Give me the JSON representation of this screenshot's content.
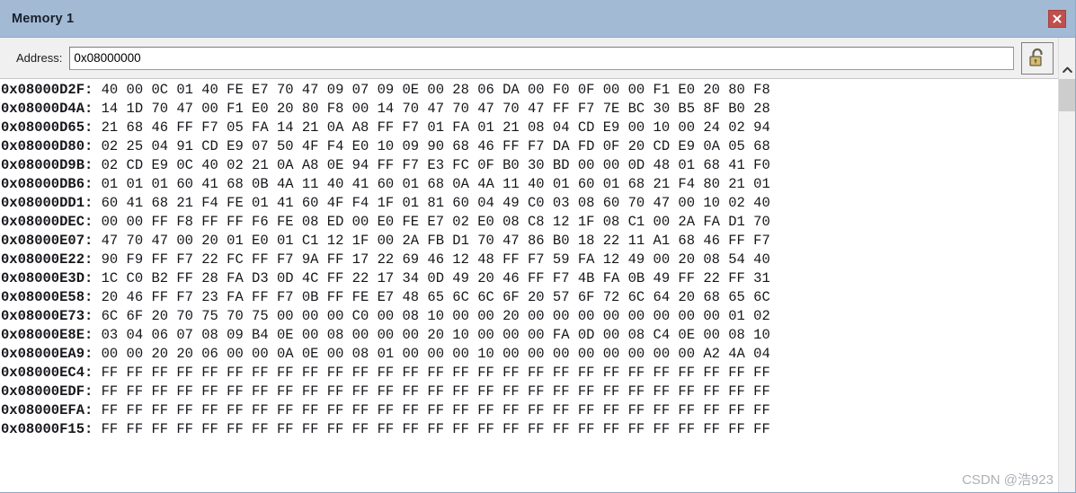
{
  "window": {
    "title": "Memory 1",
    "close_icon": "close-icon",
    "close_color": "#c0504d",
    "titlebar_color": "#a3bad4"
  },
  "toolbar": {
    "address_label": "Address:",
    "address_value": "0x08000000",
    "address_placeholder": "0x00000000",
    "lock_icon": "unlocked-padlock-icon",
    "scroll_up_icon": "chevron-up-icon"
  },
  "memory": {
    "rows": [
      {
        "address": "0x08000D2F:",
        "bytes": "40 00 0C 01 40 FE E7 70 47 09 07 09 0E 00 28 06 DA 00 F0 0F 00 00 F1 E0 20 80 F8"
      },
      {
        "address": "0x08000D4A:",
        "bytes": "14 1D 70 47 00 F1 E0 20 80 F8 00 14 70 47 70 47 70 47 FF F7 7E BC 30 B5 8F B0 28"
      },
      {
        "address": "0x08000D65:",
        "bytes": "21 68 46 FF F7 05 FA 14 21 0A A8 FF F7 01 FA 01 21 08 04 CD E9 00 10 00 24 02 94"
      },
      {
        "address": "0x08000D80:",
        "bytes": "02 25 04 91 CD E9 07 50 4F F4 E0 10 09 90 68 46 FF F7 DA FD 0F 20 CD E9 0A 05 68"
      },
      {
        "address": "0x08000D9B:",
        "bytes": "02 CD E9 0C 40 02 21 0A A8 0E 94 FF F7 E3 FC 0F B0 30 BD 00 00 0D 48 01 68 41 F0"
      },
      {
        "address": "0x08000DB6:",
        "bytes": "01 01 01 60 41 68 0B 4A 11 40 41 60 01 68 0A 4A 11 40 01 60 01 68 21 F4 80 21 01"
      },
      {
        "address": "0x08000DD1:",
        "bytes": "60 41 68 21 F4 FE 01 41 60 4F F4 1F 01 81 60 04 49 C0 03 08 60 70 47 00 10 02 40"
      },
      {
        "address": "0x08000DEC:",
        "bytes": "00 00 FF F8 FF FF F6 FE 08 ED 00 E0 FE E7 02 E0 08 C8 12 1F 08 C1 00 2A FA D1 70"
      },
      {
        "address": "0x08000E07:",
        "bytes": "47 70 47 00 20 01 E0 01 C1 12 1F 00 2A FB D1 70 47 86 B0 18 22 11 A1 68 46 FF F7"
      },
      {
        "address": "0x08000E22:",
        "bytes": "90 F9 FF F7 22 FC FF F7 9A FF 17 22 69 46 12 48 FF F7 59 FA 12 49 00 20 08 54 40"
      },
      {
        "address": "0x08000E3D:",
        "bytes": "1C C0 B2 FF 28 FA D3 0D 4C FF 22 17 34 0D 49 20 46 FF F7 4B FA 0B 49 FF 22 FF 31"
      },
      {
        "address": "0x08000E58:",
        "bytes": "20 46 FF F7 23 FA FF F7 0B FF FE E7 48 65 6C 6C 6F 20 57 6F 72 6C 64 20 68 65 6C"
      },
      {
        "address": "0x08000E73:",
        "bytes": "6C 6F 20 70 75 70 75 00 00 00 C0 00 08 10 00 00 20 00 00 00 00 00 00 00 00 01 02"
      },
      {
        "address": "0x08000E8E:",
        "bytes": "03 04 06 07 08 09 B4 0E 00 08 00 00 00 20 10 00 00 00 FA 0D 00 08 C4 0E 00 08 10"
      },
      {
        "address": "0x08000EA9:",
        "bytes": "00 00 20 20 06 00 00 0A 0E 00 08 01 00 00 00 10 00 00 00 00 00 00 00 00 A2 4A 04"
      },
      {
        "address": "0x08000EC4:",
        "bytes": "FF FF FF FF FF FF FF FF FF FF FF FF FF FF FF FF FF FF FF FF FF FF FF FF FF FF FF"
      },
      {
        "address": "0x08000EDF:",
        "bytes": "FF FF FF FF FF FF FF FF FF FF FF FF FF FF FF FF FF FF FF FF FF FF FF FF FF FF FF"
      },
      {
        "address": "0x08000EFA:",
        "bytes": "FF FF FF FF FF FF FF FF FF FF FF FF FF FF FF FF FF FF FF FF FF FF FF FF FF FF FF"
      },
      {
        "address": "0x08000F15:",
        "bytes": "FF FF FF FF FF FF FF FF FF FF FF FF FF FF FF FF FF FF FF FF FF FF FF FF FF FF FF"
      }
    ]
  },
  "watermark": {
    "text": "CSDN @浩923"
  }
}
